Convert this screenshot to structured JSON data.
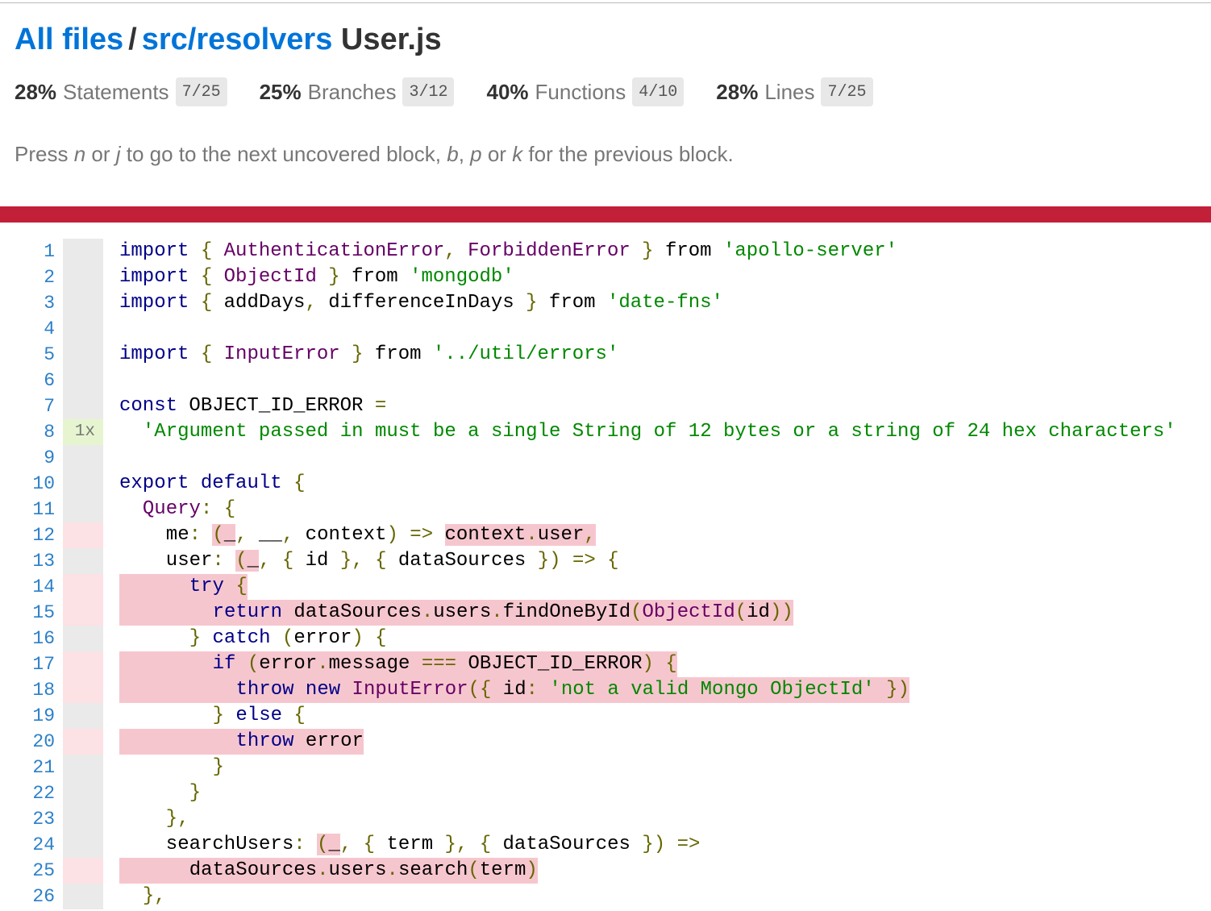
{
  "breadcrumb": {
    "all_files": "All files",
    "separator": "/",
    "directory": "src/resolvers",
    "file": "User.js"
  },
  "metrics": [
    {
      "percent": "28%",
      "label": "Statements",
      "fraction": "7/25"
    },
    {
      "percent": "25%",
      "label": "Branches",
      "fraction": "3/12"
    },
    {
      "percent": "40%",
      "label": "Functions",
      "fraction": "4/10"
    },
    {
      "percent": "28%",
      "label": "Lines",
      "fraction": "7/25"
    }
  ],
  "hint": {
    "t1": "Press ",
    "k1": "n",
    "t2": " or ",
    "k2": "j",
    "t3": " to go to the next uncovered block, ",
    "k3": "b",
    "t4": ", ",
    "k4": "p",
    "t5": " or ",
    "k5": "k",
    "t6": " for the previous block."
  },
  "colors": {
    "link": "#0074d9",
    "status_bar": "#c21f39",
    "uncovered": "#f6c6ce",
    "covered_hits": "#e6f5d0",
    "line_number": "#2c80c9"
  },
  "lines": [
    {
      "n": "1",
      "hits": "",
      "cov": "neutral",
      "uncovered": false,
      "indent": 0,
      "tokens": [
        {
          "t": "import",
          "c": "kw"
        },
        {
          "t": " "
        },
        {
          "t": "{",
          "c": "pn"
        },
        {
          "t": " "
        },
        {
          "t": "AuthenticationError",
          "c": "ty"
        },
        {
          "t": ",",
          "c": "pn"
        },
        {
          "t": " "
        },
        {
          "t": "ForbiddenError",
          "c": "ty"
        },
        {
          "t": " "
        },
        {
          "t": "}",
          "c": "pn"
        },
        {
          "t": " from "
        },
        {
          "t": "'apollo-server'",
          "c": "str"
        }
      ]
    },
    {
      "n": "2",
      "hits": "",
      "cov": "neutral",
      "uncovered": false,
      "indent": 0,
      "tokens": [
        {
          "t": "import",
          "c": "kw"
        },
        {
          "t": " "
        },
        {
          "t": "{",
          "c": "pn"
        },
        {
          "t": " "
        },
        {
          "t": "ObjectId",
          "c": "ty"
        },
        {
          "t": " "
        },
        {
          "t": "}",
          "c": "pn"
        },
        {
          "t": " from "
        },
        {
          "t": "'mongodb'",
          "c": "str"
        }
      ]
    },
    {
      "n": "3",
      "hits": "",
      "cov": "neutral",
      "uncovered": false,
      "indent": 0,
      "tokens": [
        {
          "t": "import",
          "c": "kw"
        },
        {
          "t": " "
        },
        {
          "t": "{",
          "c": "pn"
        },
        {
          "t": " addDays"
        },
        {
          "t": ",",
          "c": "pn"
        },
        {
          "t": " differenceInDays "
        },
        {
          "t": "}",
          "c": "pn"
        },
        {
          "t": " from "
        },
        {
          "t": "'date-fns'",
          "c": "str"
        }
      ]
    },
    {
      "n": "4",
      "hits": "",
      "cov": "neutral",
      "uncovered": false,
      "indent": 0,
      "tokens": []
    },
    {
      "n": "5",
      "hits": "",
      "cov": "neutral",
      "uncovered": false,
      "indent": 0,
      "tokens": [
        {
          "t": "import",
          "c": "kw"
        },
        {
          "t": " "
        },
        {
          "t": "{",
          "c": "pn"
        },
        {
          "t": " "
        },
        {
          "t": "InputError",
          "c": "ty"
        },
        {
          "t": " "
        },
        {
          "t": "}",
          "c": "pn"
        },
        {
          "t": " from "
        },
        {
          "t": "'../util/errors'",
          "c": "str"
        }
      ]
    },
    {
      "n": "6",
      "hits": "",
      "cov": "neutral",
      "uncovered": false,
      "indent": 0,
      "tokens": []
    },
    {
      "n": "7",
      "hits": "",
      "cov": "neutral",
      "uncovered": false,
      "indent": 0,
      "tokens": [
        {
          "t": "const",
          "c": "kw"
        },
        {
          "t": " OBJECT_ID_ERROR "
        },
        {
          "t": "=",
          "c": "pn"
        }
      ]
    },
    {
      "n": "8",
      "hits": "1x",
      "cov": "yes",
      "uncovered": false,
      "indent": 2,
      "tokens": [
        {
          "t": "'Argument passed in must be a single String of 12 bytes or a string of 24 hex characters'",
          "c": "str"
        }
      ]
    },
    {
      "n": "9",
      "hits": "",
      "cov": "neutral",
      "uncovered": false,
      "indent": 0,
      "tokens": []
    },
    {
      "n": "10",
      "hits": "",
      "cov": "neutral",
      "uncovered": false,
      "indent": 0,
      "tokens": [
        {
          "t": "export",
          "c": "kw"
        },
        {
          "t": " "
        },
        {
          "t": "default",
          "c": "kw"
        },
        {
          "t": " "
        },
        {
          "t": "{",
          "c": "pn"
        }
      ]
    },
    {
      "n": "11",
      "hits": "",
      "cov": "neutral",
      "uncovered": false,
      "indent": 2,
      "tokens": [
        {
          "t": "Query",
          "c": "ty"
        },
        {
          "t": ":",
          "c": "pn"
        },
        {
          "t": " "
        },
        {
          "t": "{",
          "c": "pn"
        }
      ]
    },
    {
      "n": "12",
      "hits": "",
      "cov": "no",
      "uncovered": false,
      "indent": 4,
      "tokens": [
        {
          "t": "me"
        },
        {
          "t": ":",
          "c": "pn"
        },
        {
          "t": " "
        },
        {
          "t": "(",
          "c": "pn",
          "u": true
        },
        {
          "t": "_",
          "u": true
        },
        {
          "t": ",",
          "c": "pn"
        },
        {
          "t": " __"
        },
        {
          "t": ",",
          "c": "pn"
        },
        {
          "t": " context"
        },
        {
          "t": ")",
          "c": "pn"
        },
        {
          "t": " "
        },
        {
          "t": "=>",
          "c": "pn"
        },
        {
          "t": " "
        },
        {
          "t": "context",
          "u": true
        },
        {
          "t": ".",
          "c": "pn",
          "u": true
        },
        {
          "t": "user",
          "u": true
        },
        {
          "t": ",",
          "c": "pn",
          "u": true
        }
      ]
    },
    {
      "n": "13",
      "hits": "",
      "cov": "neutral",
      "uncovered": false,
      "indent": 4,
      "tokens": [
        {
          "t": "user"
        },
        {
          "t": ":",
          "c": "pn"
        },
        {
          "t": " "
        },
        {
          "t": "(",
          "c": "pn",
          "u": true
        },
        {
          "t": "_",
          "u": true
        },
        {
          "t": ",",
          "c": "pn"
        },
        {
          "t": " "
        },
        {
          "t": "{",
          "c": "pn"
        },
        {
          "t": " id "
        },
        {
          "t": "}",
          "c": "pn"
        },
        {
          "t": ",",
          "c": "pn"
        },
        {
          "t": " "
        },
        {
          "t": "{",
          "c": "pn"
        },
        {
          "t": " dataSources "
        },
        {
          "t": "})",
          "c": "pn"
        },
        {
          "t": " "
        },
        {
          "t": "=>",
          "c": "pn"
        },
        {
          "t": " "
        },
        {
          "t": "{",
          "c": "pn"
        }
      ]
    },
    {
      "n": "14",
      "hits": "",
      "cov": "no",
      "uncovered": true,
      "indent": 6,
      "tokens": [
        {
          "t": "try",
          "c": "kw"
        },
        {
          "t": " "
        },
        {
          "t": "{",
          "c": "pn"
        }
      ]
    },
    {
      "n": "15",
      "hits": "",
      "cov": "no",
      "uncovered": true,
      "indent": 8,
      "tokens": [
        {
          "t": "return",
          "c": "kw"
        },
        {
          "t": " dataSources"
        },
        {
          "t": ".",
          "c": "pn"
        },
        {
          "t": "users"
        },
        {
          "t": ".",
          "c": "pn"
        },
        {
          "t": "findOneById"
        },
        {
          "t": "(",
          "c": "pn"
        },
        {
          "t": "ObjectId",
          "c": "ty"
        },
        {
          "t": "(",
          "c": "pn"
        },
        {
          "t": "id"
        },
        {
          "t": "))",
          "c": "pn"
        }
      ]
    },
    {
      "n": "16",
      "hits": "",
      "cov": "neutral",
      "uncovered": false,
      "indent": 6,
      "tokens": [
        {
          "t": "}",
          "c": "pn"
        },
        {
          "t": " "
        },
        {
          "t": "catch",
          "c": "kw"
        },
        {
          "t": " "
        },
        {
          "t": "(",
          "c": "pn"
        },
        {
          "t": "error"
        },
        {
          "t": ")",
          "c": "pn"
        },
        {
          "t": " "
        },
        {
          "t": "{",
          "c": "pn"
        }
      ]
    },
    {
      "n": "17",
      "hits": "",
      "cov": "no",
      "uncovered": true,
      "indent": 8,
      "tokens": [
        {
          "t": "if",
          "c": "kw"
        },
        {
          "t": " "
        },
        {
          "t": "(",
          "c": "pn"
        },
        {
          "t": "error"
        },
        {
          "t": ".",
          "c": "pn"
        },
        {
          "t": "message "
        },
        {
          "t": "===",
          "c": "pn"
        },
        {
          "t": " OBJECT_ID_ERROR"
        },
        {
          "t": ")",
          "c": "pn"
        },
        {
          "t": " "
        },
        {
          "t": "{",
          "c": "pn"
        }
      ]
    },
    {
      "n": "18",
      "hits": "",
      "cov": "no",
      "uncovered": true,
      "indent": 10,
      "tokens": [
        {
          "t": "throw",
          "c": "kw"
        },
        {
          "t": " "
        },
        {
          "t": "new",
          "c": "kw"
        },
        {
          "t": " "
        },
        {
          "t": "InputError",
          "c": "ty"
        },
        {
          "t": "({",
          "c": "pn"
        },
        {
          "t": " id"
        },
        {
          "t": ":",
          "c": "pn"
        },
        {
          "t": " "
        },
        {
          "t": "'not a valid Mongo ObjectId'",
          "c": "str"
        },
        {
          "t": " "
        },
        {
          "t": "})",
          "c": "pn"
        }
      ]
    },
    {
      "n": "19",
      "hits": "",
      "cov": "neutral",
      "uncovered": false,
      "indent": 8,
      "tokens": [
        {
          "t": "}",
          "c": "pn"
        },
        {
          "t": " "
        },
        {
          "t": "else",
          "c": "kw"
        },
        {
          "t": " "
        },
        {
          "t": "{",
          "c": "pn"
        }
      ]
    },
    {
      "n": "20",
      "hits": "",
      "cov": "no",
      "uncovered": true,
      "indent": 10,
      "tokens": [
        {
          "t": "throw",
          "c": "kw"
        },
        {
          "t": " error"
        }
      ]
    },
    {
      "n": "21",
      "hits": "",
      "cov": "neutral",
      "uncovered": false,
      "indent": 8,
      "tokens": [
        {
          "t": "}",
          "c": "pn"
        }
      ]
    },
    {
      "n": "22",
      "hits": "",
      "cov": "neutral",
      "uncovered": false,
      "indent": 6,
      "tokens": [
        {
          "t": "}",
          "c": "pn"
        }
      ]
    },
    {
      "n": "23",
      "hits": "",
      "cov": "neutral",
      "uncovered": false,
      "indent": 4,
      "tokens": [
        {
          "t": "},",
          "c": "pn"
        }
      ]
    },
    {
      "n": "24",
      "hits": "",
      "cov": "neutral",
      "uncovered": false,
      "indent": 4,
      "tokens": [
        {
          "t": "searchUsers"
        },
        {
          "t": ":",
          "c": "pn"
        },
        {
          "t": " "
        },
        {
          "t": "(",
          "c": "pn",
          "u": true
        },
        {
          "t": "_",
          "u": true
        },
        {
          "t": ",",
          "c": "pn"
        },
        {
          "t": " "
        },
        {
          "t": "{",
          "c": "pn"
        },
        {
          "t": " term "
        },
        {
          "t": "}",
          "c": "pn"
        },
        {
          "t": ",",
          "c": "pn"
        },
        {
          "t": " "
        },
        {
          "t": "{",
          "c": "pn"
        },
        {
          "t": " dataSources "
        },
        {
          "t": "})",
          "c": "pn"
        },
        {
          "t": " "
        },
        {
          "t": "=>",
          "c": "pn"
        }
      ]
    },
    {
      "n": "25",
      "hits": "",
      "cov": "no",
      "uncovered": true,
      "indent": 6,
      "tokens": [
        {
          "t": "dataSources"
        },
        {
          "t": ".",
          "c": "pn"
        },
        {
          "t": "users"
        },
        {
          "t": ".",
          "c": "pn"
        },
        {
          "t": "search"
        },
        {
          "t": "(",
          "c": "pn"
        },
        {
          "t": "term"
        },
        {
          "t": ")",
          "c": "pn"
        }
      ]
    },
    {
      "n": "26",
      "hits": "",
      "cov": "neutral",
      "uncovered": false,
      "indent": 2,
      "tokens": [
        {
          "t": "},",
          "c": "pn"
        }
      ]
    }
  ]
}
